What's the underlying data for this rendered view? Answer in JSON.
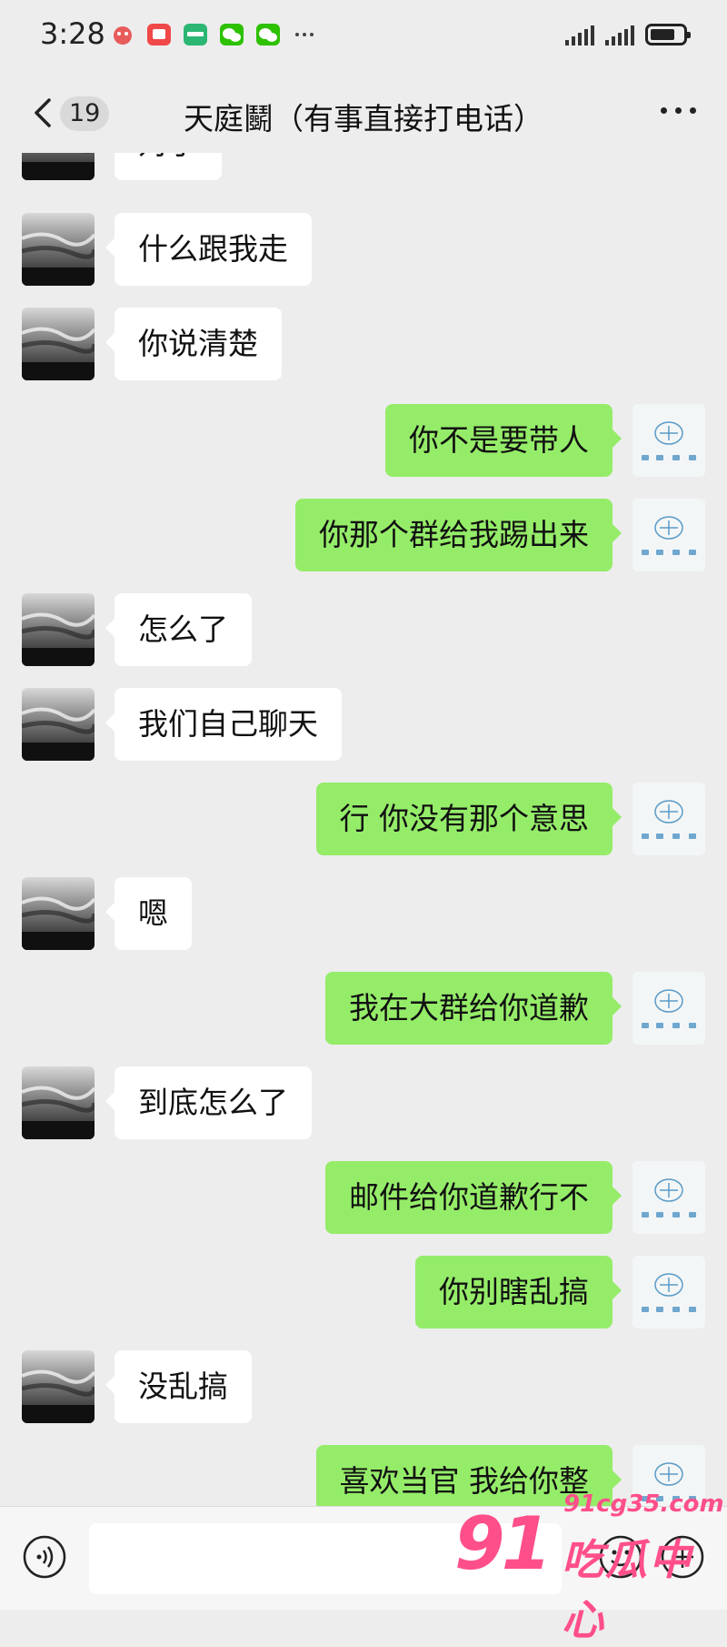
{
  "status_bar": {
    "time": "3:28"
  },
  "nav": {
    "unread_count": "19",
    "title": "天庭鬭（有事直接打电话）"
  },
  "messages": [
    {
      "side": "in",
      "text": "对了"
    },
    {
      "side": "in",
      "text": "什么跟我走"
    },
    {
      "side": "in",
      "text": "你说清楚"
    },
    {
      "side": "out",
      "text": "你不是要带人"
    },
    {
      "side": "out",
      "text": "你那个群给我踢出来"
    },
    {
      "side": "in",
      "text": "怎么了"
    },
    {
      "side": "in",
      "text": "我们自己聊天"
    },
    {
      "side": "out",
      "text": "行 你没有那个意思"
    },
    {
      "side": "in",
      "text": "嗯"
    },
    {
      "side": "out",
      "text": "我在大群给你道歉"
    },
    {
      "side": "in",
      "text": "到底怎么了"
    },
    {
      "side": "out",
      "text": "邮件给你道歉行不"
    },
    {
      "side": "out",
      "text": "你别瞎乱搞"
    },
    {
      "side": "in",
      "text": "没乱搞"
    },
    {
      "side": "out",
      "text": "喜欢当官 我给你整"
    }
  ],
  "input": {
    "value": ""
  },
  "watermark": {
    "logo": "91",
    "url": "91cg35.com",
    "text": "吃瓜中心"
  },
  "colors": {
    "outgoing_bubble": "#95ec69",
    "incoming_bubble": "#ffffff",
    "background": "#ededed",
    "watermark": "#ff4f8b"
  }
}
